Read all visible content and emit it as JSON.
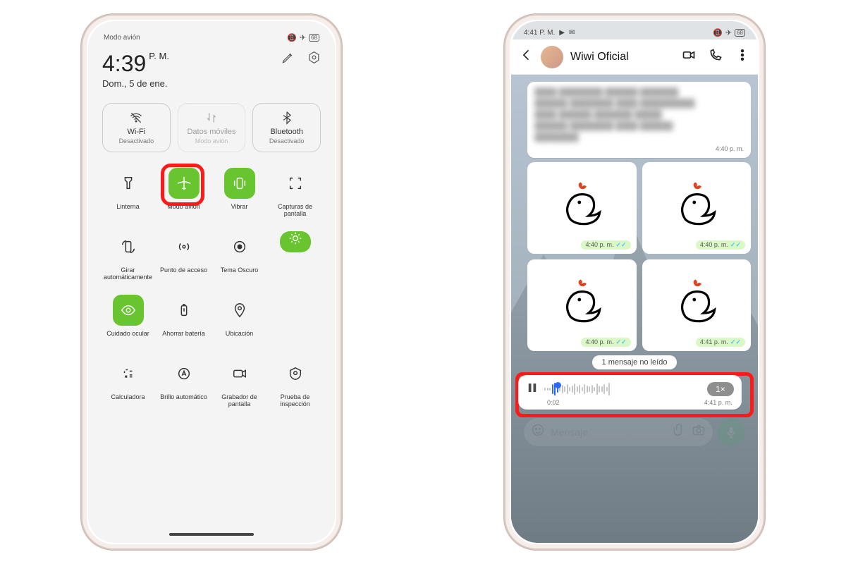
{
  "phone1": {
    "statusbar_left": "Modo avión",
    "statusbar_icons": [
      "signal-off",
      "airplane",
      "battery-68"
    ],
    "time": "4:39",
    "ampm": "P. M.",
    "date": "Dom., 5 de ene.",
    "topicons": [
      "edit-icon",
      "settings-hex-icon"
    ],
    "large_tiles": [
      {
        "icon": "wifi-off",
        "label": "Wi-Fi",
        "caption": "Desactivado",
        "disabled": false
      },
      {
        "icon": "data",
        "label": "Datos móviles",
        "caption": "Modo avión",
        "disabled": true
      },
      {
        "icon": "bluetooth",
        "label": "Bluetooth",
        "caption": "Desactivado",
        "disabled": false
      }
    ],
    "tiles": [
      {
        "icon": "flashlight",
        "label": "Linterna",
        "active": false
      },
      {
        "icon": "airplane",
        "label": "Modo avión",
        "active": true,
        "highlighted": true
      },
      {
        "icon": "vibrate",
        "label": "Vibrar",
        "active": true
      },
      {
        "icon": "crop",
        "label": "Capturas de pantalla",
        "active": false
      },
      {
        "icon": "rotate",
        "label": "Girar automáticamente",
        "active": false
      },
      {
        "icon": "hotspot",
        "label": "Punto de acceso",
        "active": false
      },
      {
        "icon": "dark",
        "label": "Tema Oscuro",
        "active": false
      },
      {
        "icon": "eye",
        "label": "Cuidado ocular",
        "active": true
      },
      {
        "icon": "battery-saver",
        "label": "Ahorrar batería",
        "active": false
      },
      {
        "icon": "location",
        "label": "Ubicación",
        "active": false
      },
      {
        "icon": "calculator",
        "label": "Calculadora",
        "active": false
      },
      {
        "icon": "auto-brightness",
        "label": "Brillo automático",
        "active": false
      },
      {
        "icon": "screen-record",
        "label": "Grabador de pantalla",
        "active": false
      },
      {
        "icon": "inspection",
        "label": "Prueba de inspección",
        "active": false
      }
    ]
  },
  "phone2": {
    "statusbar_time": "4:41 P. M.",
    "statusbar_icons_left": [
      "play-icon",
      "whatsapp-icon"
    ],
    "statusbar_icons_right": [
      "signal-off",
      "airplane",
      "battery-68"
    ],
    "contact_name": "Wiwi Oficial",
    "header_actions": [
      "video-call-icon",
      "voice-call-icon",
      "menu-icon"
    ],
    "text_msg_time": "4:40 p. m.",
    "sticker_times": [
      "4:40 p. m.",
      "4:40 p. m.",
      "4:40 p. m.",
      "4:41 p. m."
    ],
    "unread_banner": "1 mensaje no leído",
    "voice": {
      "elapsed": "0:02",
      "time": "4:41 p. m.",
      "speed": "1×"
    },
    "input_placeholder": "Mensaje"
  },
  "colors": {
    "accent_green": "#68c42f",
    "whatsapp_green": "#25d366",
    "highlight_red": "#ff1a1a"
  }
}
